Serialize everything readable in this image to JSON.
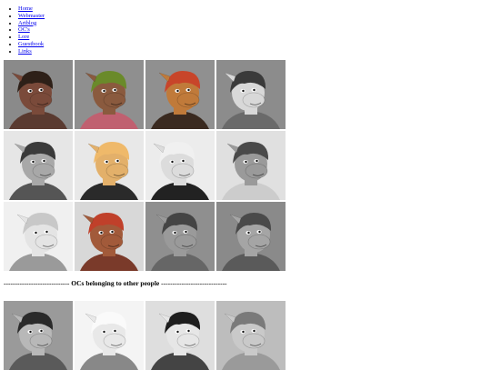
{
  "nav": [
    "Home",
    "Webmaster",
    "Artblog",
    "OC's",
    "Lore",
    "Guestbook",
    "Links"
  ],
  "grid_own": [
    {
      "icon": "oc-portrait-1-icon",
      "bg": "#8a8a8a",
      "skin": "#7a4a3a",
      "hair": "#2e2018",
      "accent": "#5a3a30"
    },
    {
      "icon": "oc-portrait-2-icon",
      "bg": "#8f8f8f",
      "skin": "#8a5a3e",
      "hair": "#6a8a2a",
      "accent": "#c06070"
    },
    {
      "icon": "oc-portrait-3-icon",
      "bg": "#909090",
      "skin": "#c07a3a",
      "hair": "#c8452a",
      "accent": "#3a2a20"
    },
    {
      "icon": "oc-portrait-4-icon",
      "bg": "#8c8c8c",
      "skin": "#d8d8d8",
      "hair": "#3a3a3a",
      "accent": "#6a6a6a"
    },
    {
      "icon": "oc-portrait-5-icon",
      "bg": "#e6e6e6",
      "skin": "#a8a8a8",
      "hair": "#3a3a3a",
      "accent": "#555555"
    },
    {
      "icon": "oc-portrait-6-icon",
      "bg": "#e8e8e8",
      "skin": "#e3b06a",
      "hair": "#efb96a",
      "accent": "#2a2a2a"
    },
    {
      "icon": "oc-portrait-7-icon",
      "bg": "#ececec",
      "skin": "#dcdcdc",
      "hair": "#f0f0f0",
      "accent": "#222222"
    },
    {
      "icon": "oc-portrait-8-icon",
      "bg": "#e0e0e0",
      "skin": "#9a9a9a",
      "hair": "#4a4a4a",
      "accent": "#cccccc"
    },
    {
      "icon": "oc-portrait-9-icon",
      "bg": "#f0f0f0",
      "skin": "#e4e4e4",
      "hair": "#c8c8c8",
      "accent": "#9a9a9a"
    },
    {
      "icon": "oc-portrait-10-icon",
      "bg": "#d8d8d8",
      "skin": "#a25a3a",
      "hair": "#c0402a",
      "accent": "#7a3a2a"
    },
    {
      "icon": "oc-portrait-11-icon",
      "bg": "#8f8f8f",
      "skin": "#9a9a9a",
      "hair": "#444444",
      "accent": "#666666"
    },
    {
      "icon": "oc-portrait-12-icon",
      "bg": "#8a8a8a",
      "skin": "#a5a5a5",
      "hair": "#4a4a4a",
      "accent": "#5a5a5a"
    }
  ],
  "divider_text": "----------------------------- OCs belonging to other people -----------------------------",
  "grid_others": [
    {
      "icon": "other-oc-portrait-1-icon",
      "bg": "#9a9a9a",
      "skin": "#b8b8b8",
      "hair": "#2a2a2a",
      "accent": "#5a5a5a"
    },
    {
      "icon": "other-oc-portrait-2-icon",
      "bg": "#f4f4f4",
      "skin": "#e8e8e8",
      "hair": "#fafafa",
      "accent": "#888888"
    },
    {
      "icon": "other-oc-portrait-3-icon",
      "bg": "#dedede",
      "skin": "#e6e6e6",
      "hair": "#1e1e1e",
      "accent": "#444444"
    },
    {
      "icon": "other-oc-portrait-4-icon",
      "bg": "#bdbdbd",
      "skin": "#c9c9c9",
      "hair": "#7a7a7a",
      "accent": "#9a9a9a"
    }
  ]
}
